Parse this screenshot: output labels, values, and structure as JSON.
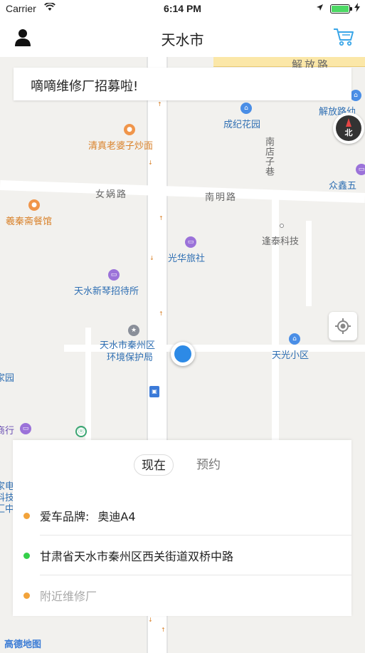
{
  "status_bar": {
    "carrier": "Carrier",
    "time": "6:14 PM"
  },
  "nav": {
    "title": "天水市",
    "left_icon": "user-icon",
    "right_icon": "cart-icon"
  },
  "banner": {
    "text": "嘀嘀维修厂招募啦!"
  },
  "map": {
    "labels": {
      "jiefang_road_top": "解放路",
      "jiefang_road_right": "解放路幼",
      "chengji_garden": "成纪花园",
      "qingzhen_restaurant": "清真老婆子炒面",
      "nandian_lane": "南店子巷",
      "nvwa_road": "女娲路",
      "nanming_road": "南明路",
      "zhongxin": "众鑫五",
      "xiqin_restaurant": "羲秦斋餐馆",
      "fengtai_tech": "逢泰科技",
      "guanghua_hotel": "光华旅社",
      "xinqin_guesthouse": "天水新琴招待所",
      "env_bureau_line1": "天水市秦州区",
      "env_bureau_line2": "环境保护局",
      "tianguang_community": "天光小区",
      "garden_left": "家园",
      "hang_left": "商行",
      "left_edge_1": "家电",
      "left_edge_2": "科技",
      "left_edge_3": "汇中",
      "amap_logo": "高德地图",
      "compass_north": "北"
    }
  },
  "order_panel": {
    "tabs": {
      "now": "现在",
      "reserve": "预约"
    },
    "brand_label": "爱车品牌:",
    "brand_value": "奥迪A4",
    "address": "甘肃省天水市秦州区西关街道双桥中路",
    "nearby": "附近维修厂"
  },
  "colors": {
    "accent_blue": "#2d8ae6",
    "dot_orange": "#f2a33a",
    "dot_green": "#35d04a"
  }
}
